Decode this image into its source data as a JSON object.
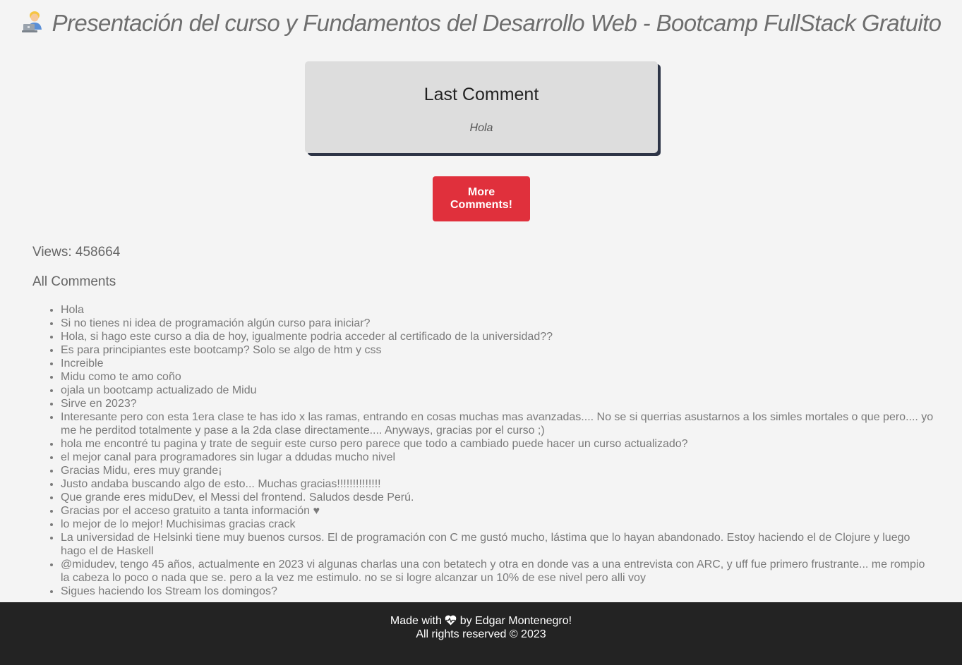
{
  "page": {
    "title": "Presentación del curso y Fundamentos del Desarrollo Web - Bootcamp FullStack Gratuito",
    "title_icon": "technologist-emoji-icon"
  },
  "last_comment": {
    "heading": "Last Comment",
    "text": "Hola"
  },
  "more_button": {
    "label": "More Comments!",
    "color": "#e0303c"
  },
  "stats": {
    "views_label": "Views: 458664"
  },
  "comments": {
    "heading": "All Comments",
    "items": [
      "Hola",
      "Si no tienes ni idea de programación algún curso para iniciar?",
      "Hola, si hago este curso a dia de hoy, igualmente podria acceder al certificado de la universidad??",
      "Es para principiantes este bootcamp? Solo se algo de htm y css",
      "Increible",
      "Midu como te amo coño",
      "ojala un bootcamp actualizado de Midu",
      "Sirve en 2023?",
      "Interesante pero con esta 1era clase te has ido x las ramas, entrando en cosas muchas mas avanzadas.... No se si querrias asustarnos a los simles mortales o que pero.... yo me he perditod totalmente y pase a la 2da clase directamente.... Anyways, gracias por el curso ;)",
      "hola me encontré tu pagina y trate de seguir este curso pero parece que todo a cambiado puede hacer un curso actualizado?",
      "el mejor canal para programadores sin lugar a ddudas mucho nivel",
      "Gracias Midu, eres muy grande¡",
      "Justo andaba buscando algo de esto... Muchas gracias!!!!!!!!!!!!!!",
      "Que grande eres miduDev, el Messi del frontend. Saludos desde Perú.",
      "Gracias por el acceso gratuito a tanta información ♥",
      "lo mejor de lo mejor! Muchisimas gracias crack",
      "La universidad de Helsinki tiene muy buenos cursos. El de programación con C me gustó mucho, lástima que lo hayan abandonado. Estoy haciendo el de Clojure y luego hago el de Haskell",
      "@midudev, tengo 45 años, actualmente en 2023 vi algunas charlas una con betatech y otra en donde vas a una entrevista con ARC, y uff fue primero frustrante... me rompio la cabeza lo poco o nada que se. pero a la vez me estimulo. no se si logre alcanzar un 10% de ese nivel pero alli voy",
      "Sigues haciendo los Stream los domingos?"
    ]
  },
  "footer": {
    "made_with_prefix": "Made with",
    "made_with_icon": "heart-pulse-icon",
    "made_with_suffix": "by Edgar Montenegro!",
    "rights": "All rights reserved © 2023"
  }
}
